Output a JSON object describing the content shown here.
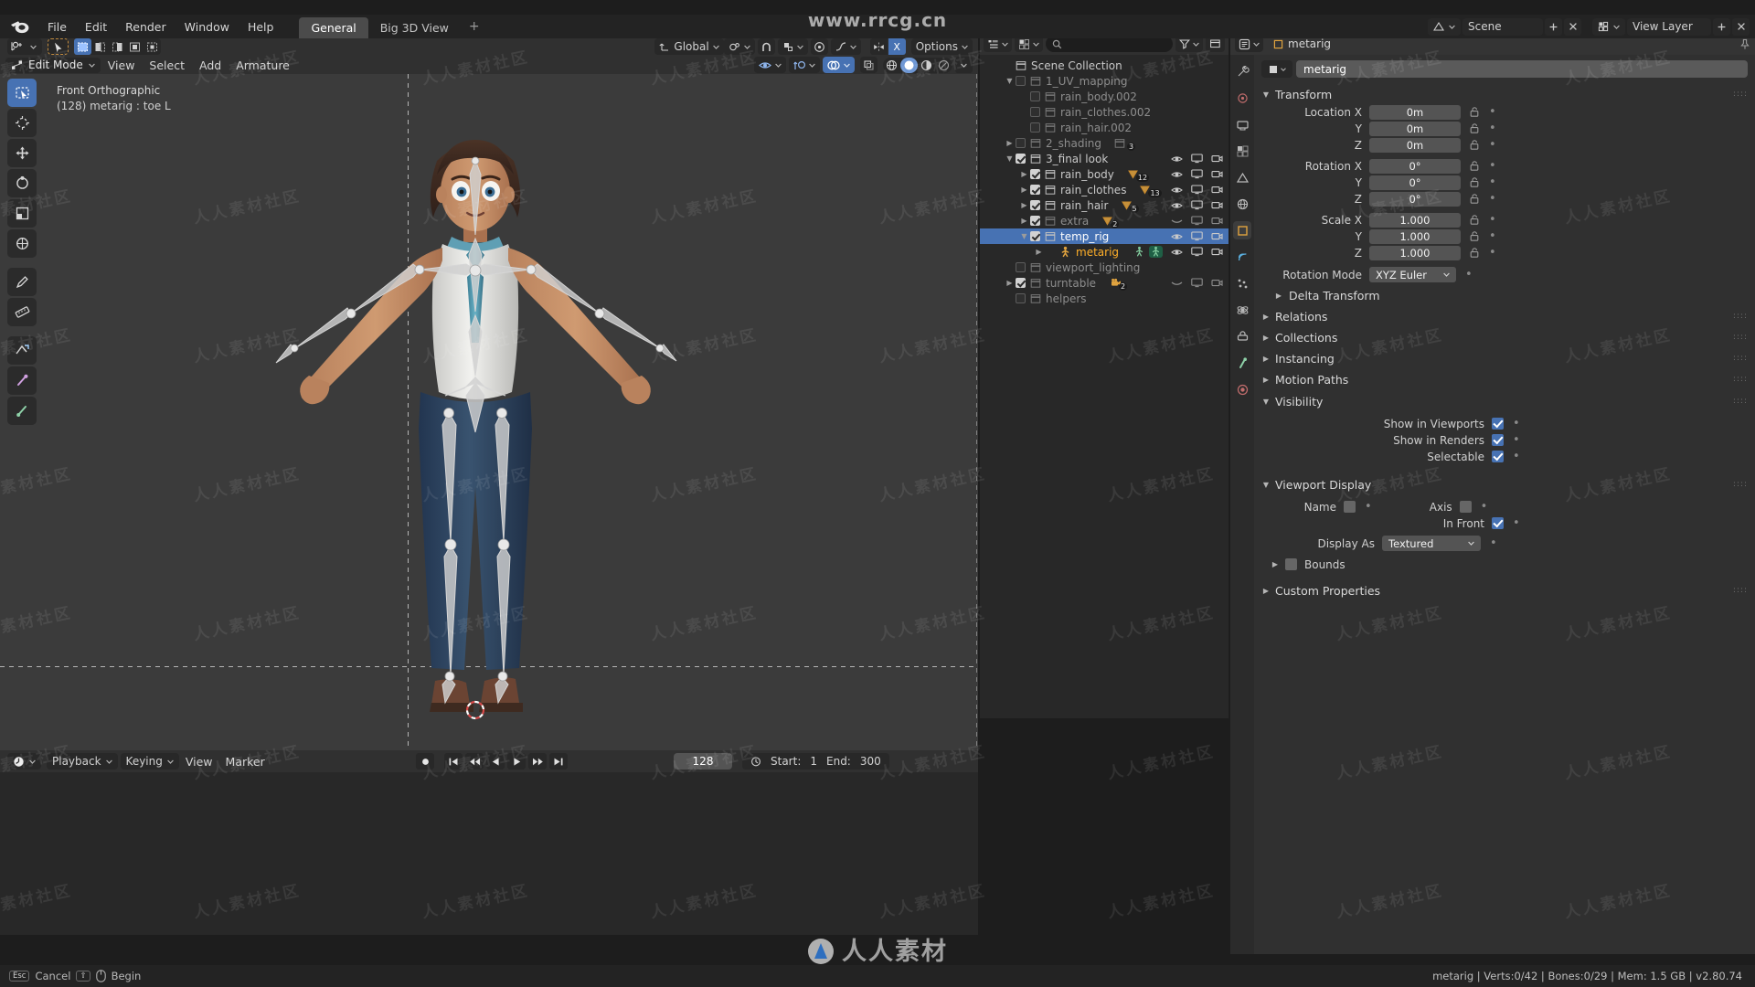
{
  "app": {
    "title": "Blender",
    "version_status": "metarig | Verts:0/42 | Bones:0/29 | Mem: 1.5 GB | v2.80.74"
  },
  "watermarks": {
    "top": "www.rrcg.cn",
    "tile": "人人素材社区",
    "bottom": "人人素材"
  },
  "topbar": {
    "logo_icon": "blender-logo-icon",
    "menus": [
      "File",
      "Edit",
      "Render",
      "Window",
      "Help"
    ],
    "workspaces": [
      {
        "label": "General",
        "active": true
      },
      {
        "label": "Big 3D View",
        "active": false
      }
    ],
    "add_workspace_label": "+",
    "scene_icon": "scene-icon",
    "scene_name": "Scene",
    "viewlayer_icon": "view-layer-icon",
    "viewlayer_name": "View Layer",
    "new_scene_icon": "new-icon",
    "remove_scene_icon": "x-icon",
    "browse_scene_icon": "browse-icon",
    "pin_icon": "pin-icon"
  },
  "toolheader": {
    "cursor_tool_icon": "cursor-add-icon",
    "tweak_icon": "tweak-select-icon",
    "select_modes": [
      "select-set-icon",
      "select-extend-icon",
      "select-subtract-icon",
      "select-invert-icon",
      "select-intersect-icon"
    ],
    "transform_orientation_icon": "orientation-icon",
    "transform_orientation": "Global",
    "pivot_icon": "pivot-icon",
    "snap_icon": "magnet-icon",
    "snap_mode_icon": "snap-increment-icon",
    "proportional_icon": "proportional-edit-icon",
    "falloff_icon": "falloff-smooth-icon",
    "mirror_x_icon": "mirror-x-icon",
    "mirror_x_label": "X",
    "options_label": "Options"
  },
  "viewport_header": {
    "mode_icon": "edit-mode-icon",
    "mode": "Edit Mode",
    "menus": [
      "View",
      "Select",
      "Add",
      "Armature"
    ],
    "visibility_icon": "eye-icon",
    "gizmo_icon": "gizmo-icon",
    "overlays_icon": "overlays-icon",
    "xray_icon": "xray-toggle-icon",
    "shading_modes": [
      "wireframe-icon",
      "solid-icon",
      "material-preview-icon",
      "rendered-icon"
    ],
    "shading_active_index": 1,
    "dropdown_icon": "chevron-down-icon"
  },
  "viewport": {
    "view_name": "Front Orthographic",
    "active_item": "(128) metarig : toe L",
    "tools": [
      {
        "icon": "select-box-icon",
        "name": "tweak-tool",
        "active": true
      },
      {
        "icon": "cursor-3d-icon",
        "name": "cursor-tool",
        "active": false
      },
      {
        "icon": "move-icon",
        "name": "move-tool",
        "active": false
      },
      {
        "icon": "rotate-icon",
        "name": "rotate-tool",
        "active": false
      },
      {
        "icon": "scale-icon",
        "name": "scale-tool",
        "active": false
      },
      {
        "icon": "transform-icon",
        "name": "transform-tool",
        "active": false
      },
      {
        "icon": "annotate-icon",
        "name": "annotate-tool",
        "active": false
      },
      {
        "icon": "measure-icon",
        "name": "measure-tool",
        "active": false
      },
      {
        "icon": "extrude-icon",
        "name": "extrude-tool",
        "active": false
      },
      {
        "icon": "bone-roll-icon",
        "name": "roll-tool",
        "active": false
      },
      {
        "icon": "bone-size-icon",
        "name": "bone-size-tool",
        "active": false
      }
    ]
  },
  "outliner": {
    "editor_icon": "outliner-icon",
    "display_mode_icon": "view-layer-icon",
    "filter_icon": "filter-icon",
    "search_icon": "search-icon",
    "search_placeholder": "",
    "new_collection_icon": "new-collection-icon",
    "rows": [
      {
        "label": "Scene Collection",
        "indent": 0,
        "icon": "collection-icon",
        "tri": "none",
        "checkbox": "none",
        "dim": false,
        "selected": false,
        "eye": false
      },
      {
        "label": "1_UV_mapping",
        "indent": 1,
        "icon": "collection-icon",
        "tri": "down",
        "checkbox": "off",
        "dim": true,
        "selected": false,
        "eye": false
      },
      {
        "label": "rain_body.002",
        "indent": 2,
        "icon": "collection-icon",
        "tri": "none",
        "checkbox": "off",
        "dim": true,
        "selected": false,
        "eye": false
      },
      {
        "label": "rain_clothes.002",
        "indent": 2,
        "icon": "collection-icon",
        "tri": "none",
        "checkbox": "off",
        "dim": true,
        "selected": false,
        "eye": false
      },
      {
        "label": "rain_hair.002",
        "indent": 2,
        "icon": "collection-icon",
        "tri": "none",
        "checkbox": "off",
        "dim": true,
        "selected": false,
        "eye": false
      },
      {
        "label": "2_shading",
        "indent": 1,
        "icon": "collection-icon",
        "tri": "right",
        "checkbox": "off",
        "dim": true,
        "selected": false,
        "eye": false,
        "badge_icon": "collection-icon",
        "badge": "3"
      },
      {
        "label": "3_final look",
        "indent": 1,
        "icon": "collection-icon",
        "tri": "down",
        "checkbox": "on",
        "dim": false,
        "selected": false,
        "eye": true
      },
      {
        "label": "rain_body",
        "indent": 2,
        "icon": "collection-icon",
        "tri": "right",
        "checkbox": "on",
        "dim": false,
        "selected": false,
        "eye": true,
        "badge_icon": "mesh-data-icon",
        "badge": "12"
      },
      {
        "label": "rain_clothes",
        "indent": 2,
        "icon": "collection-icon",
        "tri": "right",
        "checkbox": "on",
        "dim": false,
        "selected": false,
        "eye": true,
        "badge_icon": "mesh-data-icon",
        "badge": "13"
      },
      {
        "label": "rain_hair",
        "indent": 2,
        "icon": "collection-icon",
        "tri": "right",
        "checkbox": "on",
        "dim": false,
        "selected": false,
        "eye": true,
        "badge_icon": "mesh-data-icon",
        "badge": "5"
      },
      {
        "label": "extra",
        "indent": 2,
        "icon": "collection-icon",
        "tri": "right",
        "checkbox": "on",
        "dim": true,
        "selected": false,
        "eye": "closed",
        "badge_icon": "mesh-data-icon",
        "badge": "2"
      },
      {
        "label": "temp_rig",
        "indent": 2,
        "icon": "collection-icon",
        "tri": "down",
        "checkbox": "on",
        "dim": false,
        "selected": true,
        "eye": true
      },
      {
        "label": "metarig",
        "indent": 3,
        "icon": "armature-icon",
        "tri": "right",
        "checkbox": "none",
        "dim": false,
        "selected": false,
        "active": true,
        "eye": true,
        "extra_icons": [
          "armature-data-icon",
          "pose-icon"
        ]
      },
      {
        "label": "viewport_lighting",
        "indent": 1,
        "icon": "collection-icon",
        "tri": "none",
        "checkbox": "off",
        "dim": true,
        "selected": false,
        "eye": false
      },
      {
        "label": "turntable",
        "indent": 1,
        "icon": "collection-icon",
        "tri": "right",
        "checkbox": "on",
        "dim": true,
        "selected": false,
        "eye": "closed",
        "badge_icon": "camera-icon",
        "badge": "2"
      },
      {
        "label": "helpers",
        "indent": 1,
        "icon": "collection-icon",
        "tri": "none",
        "checkbox": "off",
        "dim": true,
        "selected": false,
        "eye": false
      }
    ]
  },
  "properties": {
    "editor_icon": "properties-icon",
    "breadcrumb_icon": "object-icon",
    "breadcrumb": "metarig",
    "pin_icon": "pin-icon",
    "tabs": [
      "tool-icon",
      "render-icon",
      "output-icon",
      "view-layer-icon",
      "scene-icon",
      "world-icon",
      "object-icon",
      "modifier-icon",
      "particles-icon",
      "physics-icon",
      "constraint-icon",
      "data-icon",
      "material-icon"
    ],
    "active_tab_index": 6,
    "id_icon": "object-icon",
    "id_name": "metarig",
    "transform": {
      "title": "Transform",
      "expanded": true,
      "rows": [
        {
          "label": "Location X",
          "value": "0m"
        },
        {
          "label": "Y",
          "value": "0m"
        },
        {
          "label": "Z",
          "value": "0m"
        },
        {
          "label": "Rotation X",
          "value": "0°"
        },
        {
          "label": "Y",
          "value": "0°"
        },
        {
          "label": "Z",
          "value": "0°"
        },
        {
          "label": "Scale X",
          "value": "1.000"
        },
        {
          "label": "Y",
          "value": "1.000"
        },
        {
          "label": "Z",
          "value": "1.000"
        }
      ],
      "rotation_mode_label": "Rotation Mode",
      "rotation_mode_value": "XYZ Euler",
      "delta_transform_label": "Delta Transform"
    },
    "panels": [
      {
        "label": "Relations",
        "expanded": false
      },
      {
        "label": "Collections",
        "expanded": false
      },
      {
        "label": "Instancing",
        "expanded": false
      },
      {
        "label": "Motion Paths",
        "expanded": false
      }
    ],
    "visibility": {
      "title": "Visibility",
      "expanded": true,
      "rows": [
        {
          "label": "Show in Viewports",
          "checked": true
        },
        {
          "label": "Show in Renders",
          "checked": true
        },
        {
          "label": "Selectable",
          "checked": true
        }
      ]
    },
    "viewport_display": {
      "title": "Viewport Display",
      "expanded": true,
      "name_label": "Name",
      "name_checked": false,
      "axis_label": "Axis",
      "axis_checked": false,
      "in_front_label": "In Front",
      "in_front_checked": true,
      "display_as_label": "Display As",
      "display_as_value": "Textured",
      "bounds_label": "Bounds",
      "bounds_checked": false
    },
    "custom_properties": {
      "label": "Custom Properties",
      "expanded": false
    }
  },
  "timeline": {
    "editor_icon": "timeline-icon",
    "menus": [
      "Playback",
      "Keying",
      "View",
      "Marker"
    ],
    "playback_dropdown_icon": "chevron-down-icon",
    "record_icon": "record-icon",
    "transport": [
      "jump-start-icon",
      "prev-keyframe-icon",
      "play-reverse-icon",
      "play-icon",
      "next-keyframe-icon",
      "jump-end-icon"
    ],
    "current_frame": "128",
    "clock_icon": "clock-icon",
    "start_label": "Start:",
    "start_value": "1",
    "end_label": "End:",
    "end_value": "300"
  },
  "statusbar": {
    "esc_key": "Esc",
    "cancel_label": "Cancel",
    "shift_key": "⇧",
    "mouse_icon": "mouse-icon",
    "begin_label": "Begin",
    "info": "metarig | Verts:0/42 | Bones:0/29 | Mem: 1.5 GB | v2.80.74"
  },
  "colors": {
    "accent": "#4772b3",
    "active_text": "#ffaf29",
    "panel_bg": "#303030",
    "editor_bg": "#282828",
    "viewport_bg": "#3b3b3b",
    "header_bg": "#232323"
  }
}
